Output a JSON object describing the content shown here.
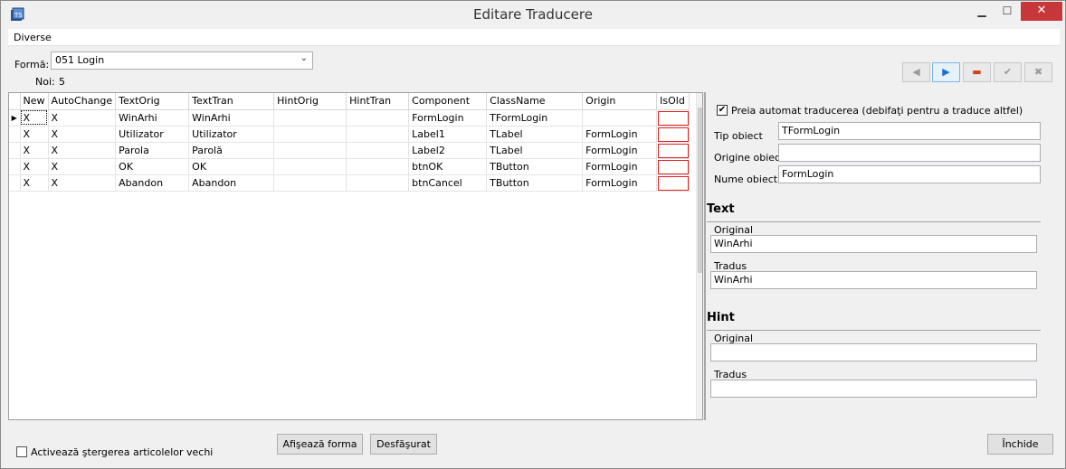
{
  "window": {
    "title": "Editare Traducere"
  },
  "menu": [
    "Diverse"
  ],
  "form_select": {
    "label": "Formă:",
    "value": "051  Login"
  },
  "noi": {
    "label": "Noi:",
    "value": "5"
  },
  "toolbar": {
    "buttons": [
      {
        "name": "prev-record-button",
        "glyph": "◀"
      },
      {
        "name": "next-record-button",
        "glyph": "▶"
      },
      {
        "name": "delete-record-button",
        "glyph": "▬"
      },
      {
        "name": "confirm-button",
        "glyph": "✔"
      },
      {
        "name": "cancel-edit-button",
        "glyph": "✖"
      }
    ]
  },
  "grid": {
    "columns": [
      "New",
      "AutoChange",
      "TextOrig",
      "TextTran",
      "HintOrig",
      "HintTran",
      "Component",
      "ClassName",
      "Origin",
      "IsOld"
    ],
    "rows": [
      [
        "X",
        "X",
        "WinArhi",
        "WinArhi",
        "",
        "",
        "FormLogin",
        "TFormLogin",
        "",
        ""
      ],
      [
        "X",
        "X",
        "Utilizator",
        "Utilizator",
        "",
        "",
        "Label1",
        "TLabel",
        "FormLogin",
        ""
      ],
      [
        "X",
        "X",
        "Parola",
        "Parolă",
        "",
        "",
        "Label2",
        "TLabel",
        "FormLogin",
        ""
      ],
      [
        "X",
        "X",
        "OK",
        "OK",
        "",
        "",
        "btnOK",
        "TButton",
        "FormLogin",
        ""
      ],
      [
        "X",
        "X",
        "Abandon",
        "Abandon",
        "",
        "",
        "btnCancel",
        "TButton",
        "FormLogin",
        ""
      ]
    ]
  },
  "detail": {
    "auto_translate_label": "Preia automat traducerea (debifaţi pentru a traduce altfel)",
    "tip_obiect": {
      "label": "Tip obiect",
      "value": "TFormLogin"
    },
    "origine_obiect": {
      "label": "Origine obiect",
      "value": ""
    },
    "nume_obiect": {
      "label": "Nume obiect",
      "value": "FormLogin"
    },
    "text_section": "Text",
    "text_original": {
      "label": "Original",
      "value": "WinArhi"
    },
    "text_tradus": {
      "label": "Tradus",
      "value": "WinArhi"
    },
    "hint_section": "Hint",
    "hint_original": {
      "label": "Original",
      "value": ""
    },
    "hint_tradus": {
      "label": "Tradus",
      "value": ""
    }
  },
  "footer": {
    "activate_delete_label": "Activează ştergerea articolelor vechi",
    "show_form_button": "Afişează forma",
    "expand_button": "Desfăşurat",
    "close_button": "Închide"
  }
}
